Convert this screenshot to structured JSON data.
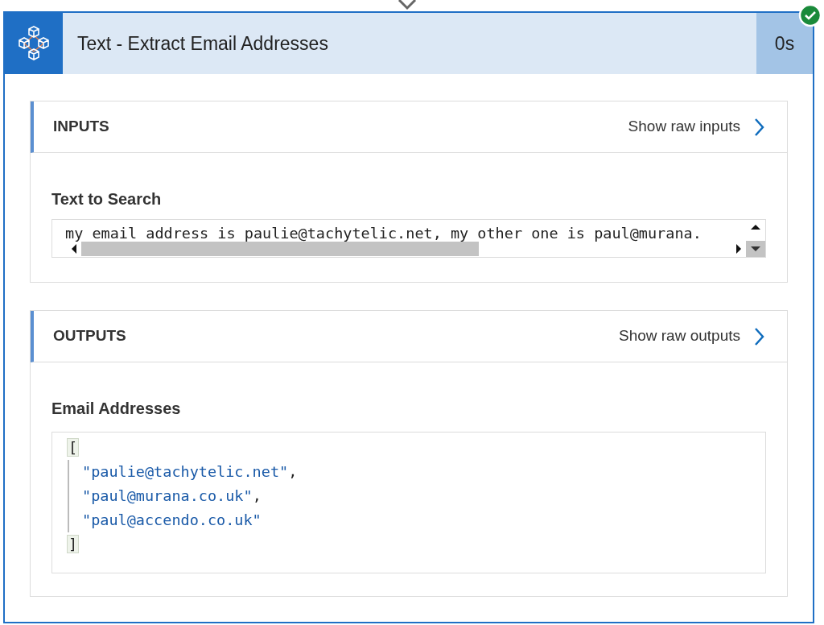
{
  "header": {
    "title": "Text - Extract Email Addresses",
    "duration": "0s",
    "succeeded": true
  },
  "inputs": {
    "heading": "INPUTS",
    "raw_link": "Show raw inputs",
    "field_label": "Text to Search",
    "field_value": "my email address is paulie@tachytelic.net, my other one is paul@murana."
  },
  "outputs": {
    "heading": "OUTPUTS",
    "raw_link": "Show raw outputs",
    "field_label": "Email Addresses",
    "json_lines": [
      {
        "kind": "bracket",
        "text": "["
      },
      {
        "kind": "string",
        "text": "\"paulie@tachytelic.net\"",
        "suffix": ","
      },
      {
        "kind": "string",
        "text": "\"paul@murana.co.uk\"",
        "suffix": ","
      },
      {
        "kind": "string",
        "text": "\"paul@accendo.co.uk\""
      },
      {
        "kind": "bracket",
        "text": "]"
      }
    ]
  }
}
